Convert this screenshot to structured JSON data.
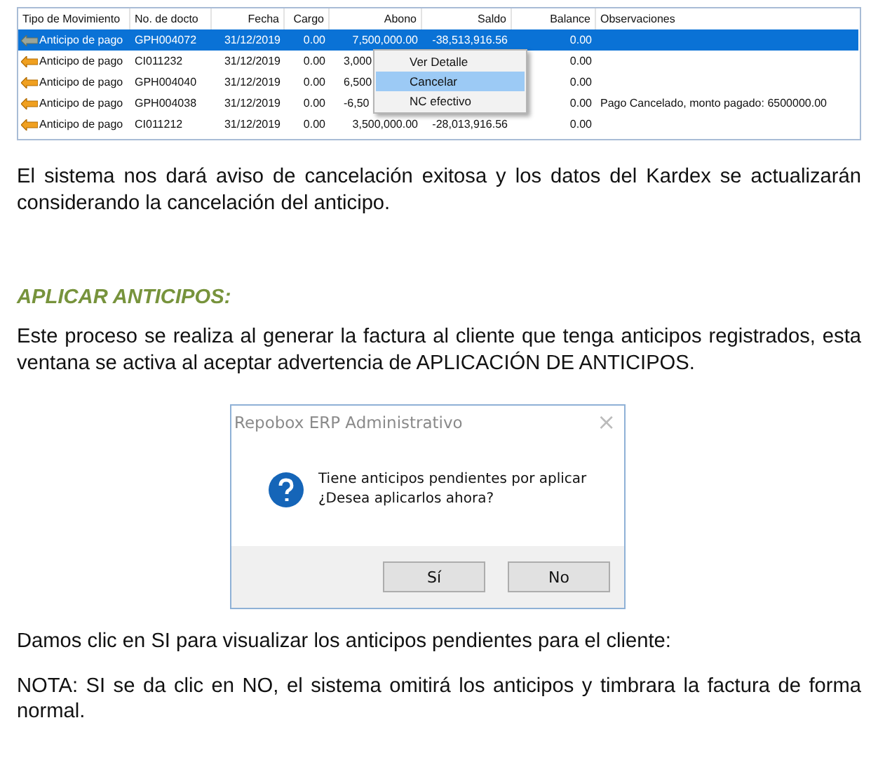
{
  "kardex_table": {
    "columns": [
      "Tipo de Movimiento",
      "No. de docto",
      "Fecha",
      "Cargo",
      "Abono",
      "Saldo",
      "Balance",
      "Observaciones"
    ],
    "rows": [
      {
        "selected": true,
        "tipo": "Anticipo de pago",
        "docto": "GPH004072",
        "fecha": "31/12/2019",
        "cargo": "0.00",
        "abono": "7,500,000.00",
        "saldo": "-38,513,916.56",
        "balance": "0.00"
      },
      {
        "selected": false,
        "tipo": "Anticipo de pago",
        "docto": "CI011232",
        "fecha": "31/12/2019",
        "cargo": "0.00",
        "abono": "3,000",
        "abono_cut": true,
        "balance": "0.00"
      },
      {
        "selected": false,
        "tipo": "Anticipo de pago",
        "docto": "GPH004040",
        "fecha": "31/12/2019",
        "cargo": "0.00",
        "abono": "6,500",
        "abono_cut": true,
        "balance": "0.00"
      },
      {
        "selected": false,
        "tipo": "Anticipo de pago",
        "docto": "GPH004038",
        "fecha": "31/12/2019",
        "cargo": "0.00",
        "abono": "-6,50",
        "abono_cut": true,
        "balance": "0.00",
        "observaciones": "Pago Cancelado, monto pagado: 6500000.00"
      },
      {
        "selected": false,
        "tipo": "Anticipo de pago",
        "docto": "CI011212",
        "fecha": "31/12/2019",
        "cargo": "0.00",
        "abono": "3,500,000.00",
        "saldo": "-28,013,916.56",
        "balance": "0.00"
      }
    ],
    "context_menu": [
      {
        "label": "Ver Detalle",
        "selected": false
      },
      {
        "label": "Cancelar",
        "selected": true
      },
      {
        "label": "NC efectivo",
        "selected": false
      }
    ]
  },
  "paragraph_1": "El sistema nos dará aviso de cancelación exitosa y los datos del Kardex se actualizarán considerando la cancelación del anticipo.",
  "heading": "APLICAR ANTICIPOS:",
  "paragraph_2": "Este proceso se realiza al generar la factura al cliente que tenga anticipos registrados, esta ventana se activa al aceptar advertencia de APLICACIÓN DE ANTICIPOS.",
  "dialog": {
    "title": "Repobox ERP Administrativo",
    "close": "×",
    "message": [
      "Tiene anticipos pendientes por aplicar",
      "¿Desea  aplicarlos ahora?"
    ],
    "buttons": [
      "Sí",
      "No"
    ]
  },
  "paragraph_3": "Damos clic en SI para visualizar los anticipos pendientes para el cliente:",
  "paragraph_4": "NOTA: SI se da clic en NO, el sistema omitirá los anticipos y timbrara la factura de forma normal."
}
